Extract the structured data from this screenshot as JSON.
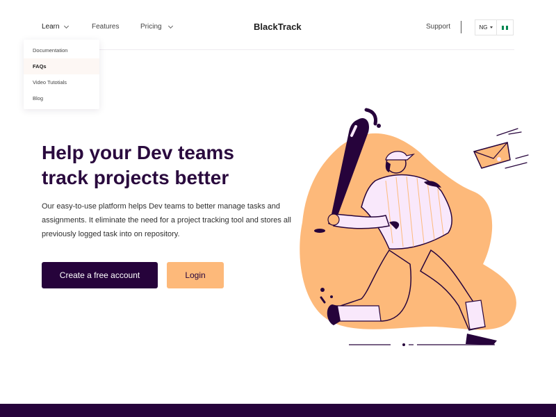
{
  "header": {
    "brand": "BlackTrack",
    "nav": [
      {
        "label": "Learn",
        "has_dropdown": true,
        "active": true
      },
      {
        "label": "Features",
        "has_dropdown": false
      },
      {
        "label": "Pricing",
        "has_dropdown": true
      }
    ],
    "support_label": "Support",
    "locale": {
      "code": "NG",
      "flag_icon": "nigeria-flag-icon",
      "flag_colors": [
        "#008751",
        "#ffffff",
        "#008751"
      ]
    }
  },
  "learn_dropdown": {
    "items": [
      {
        "label": "Documentation"
      },
      {
        "label": "FAQs",
        "highlighted": true
      },
      {
        "label": "Video Tutotials"
      },
      {
        "label": "Blog"
      }
    ]
  },
  "hero": {
    "title_line1": "Help your Dev teams",
    "title_line2": "track projects better",
    "description": "Our easy-to-use platform helps Dev teams to better manage tasks and assignments. It eliminate the need for a project tracking tool and stores all previously logged task into on repository.",
    "primary_cta": "Create a free account",
    "secondary_cta": "Login",
    "illustration": "baseball-player-illustration"
  },
  "colors": {
    "primary": "#26033b",
    "accent": "#fdb97a",
    "illustration_light": "#f9e8fb"
  }
}
